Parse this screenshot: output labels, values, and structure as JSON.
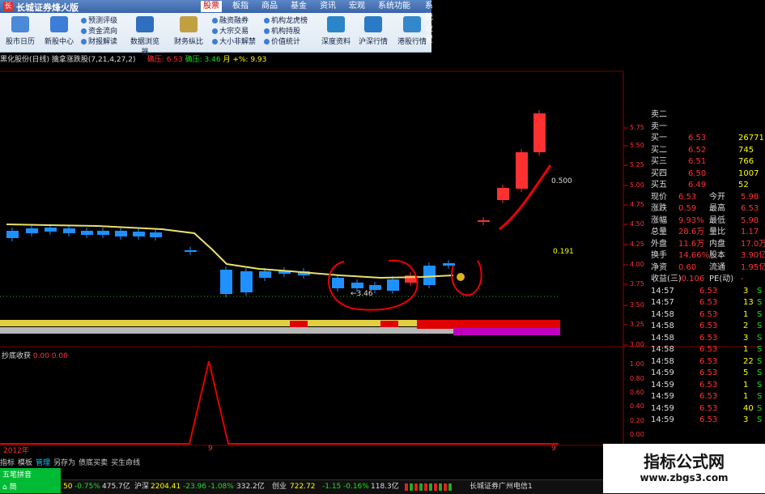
{
  "window": {
    "title": "长城证券烽火版",
    "menus": [
      "股票",
      "板指",
      "商品",
      "基金",
      "资讯",
      "宏观",
      "系统功能",
      "系统设置"
    ],
    "active_menu": "股票"
  },
  "toolbar": {
    "buttons": [
      "股市日历",
      "新股中心",
      "数据浏览器",
      "财务纵比",
      "深度资料",
      "沪深行情",
      "港股行情"
    ],
    "col1": [
      "预测评级",
      "资金流向",
      "财报解读"
    ],
    "col2": [
      "融资融券",
      "大宗交易",
      "大小非解禁"
    ],
    "col3": [
      "机构龙虎榜",
      "机构持股",
      "价值统计"
    ]
  },
  "infoline": {
    "stock": "黑化股份(日线)",
    "indicator": "擒拿涨跌股(7,21,4,27,2)",
    "high_label": "确压:",
    "high_val": "6.53",
    "low_label": "确压:",
    "low_val": "3.46",
    "month_label": "月 +%:",
    "month_val": "9.93"
  },
  "chart_labels": {
    "annotation_high": "0.500",
    "annotation_mid": "0.191",
    "low_mark": "←3.46",
    "sub_title": "抄底收获",
    "sub_val1": "0.00",
    "sub_val2": "0.00",
    "year_label": "2012年",
    "month_a": "9",
    "month_b": "9"
  },
  "price_axis": [
    "5.75",
    "5.50",
    "5.25",
    "5.00",
    "4.75",
    "4.50",
    "4.25",
    "4.00",
    "3.75",
    "3.50",
    "3.25",
    "3.00"
  ],
  "sub_axis": [
    "1.00",
    "0.80",
    "0.60",
    "0.40",
    "0.20",
    "0.00"
  ],
  "orderbook": {
    "asks": [
      {
        "l": "卖二",
        "p": "",
        "v": ""
      },
      {
        "l": "卖一",
        "p": "",
        "v": ""
      }
    ],
    "bids": [
      {
        "l": "买一",
        "p": "6.53",
        "v": "26771"
      },
      {
        "l": "买二",
        "p": "6.52",
        "v": "745"
      },
      {
        "l": "买三",
        "p": "6.51",
        "v": "766"
      },
      {
        "l": "买四",
        "p": "6.50",
        "v": "1007"
      },
      {
        "l": "买五",
        "p": "6.49",
        "v": "52"
      }
    ]
  },
  "quote": [
    {
      "a": "现价",
      "av": "6.53",
      "b": "今开",
      "bv": "5.98"
    },
    {
      "a": "涨跌",
      "av": "0.59",
      "b": "最高",
      "bv": "6.53"
    },
    {
      "a": "涨幅",
      "av": "9.93%",
      "b": "最低",
      "bv": "5.98"
    },
    {
      "a": "总量",
      "av": "28.6万",
      "b": "量比",
      "bv": "1.17"
    },
    {
      "a": "外盘",
      "av": "11.6万",
      "b": "内盘",
      "bv": "17.0万"
    },
    {
      "a": "换手",
      "av": "14.66%",
      "b": "股本",
      "bv": "3.90亿"
    },
    {
      "a": "净资",
      "av": "0.60",
      "b": "流通",
      "bv": "1.95亿"
    },
    {
      "a": "收益(三)",
      "av": "-0.106",
      "b": "PE(动)",
      "bv": "-"
    }
  ],
  "ticks": [
    {
      "t": "14:57",
      "p": "6.53",
      "v": "3",
      "s": "S"
    },
    {
      "t": "14:57",
      "p": "6.53",
      "v": "13",
      "s": "S"
    },
    {
      "t": "14:58",
      "p": "6.53",
      "v": "1",
      "s": "S"
    },
    {
      "t": "14:58",
      "p": "6.53",
      "v": "2",
      "s": "S"
    },
    {
      "t": "14:58",
      "p": "6.53",
      "v": "3",
      "s": "S"
    },
    {
      "t": "14:58",
      "p": "6.53",
      "v": "1",
      "s": "S"
    },
    {
      "t": "14:58",
      "p": "6.53",
      "v": "22",
      "s": "S"
    },
    {
      "t": "14:59",
      "p": "6.53",
      "v": "5",
      "s": "S"
    },
    {
      "t": "14:59",
      "p": "6.53",
      "v": "1",
      "s": "S"
    },
    {
      "t": "14:59",
      "p": "6.53",
      "v": "1",
      "s": "S"
    },
    {
      "t": "14:59",
      "p": "6.53",
      "v": "40",
      "s": "S"
    },
    {
      "t": "14:59",
      "p": "6.53",
      "v": "3",
      "s": "S"
    }
  ],
  "tabs": [
    "指标",
    "模板",
    "管理",
    "另存为",
    "债底买卖",
    "买生命线"
  ],
  "selected_tab": "管理",
  "ime": {
    "label": "五笔拼音",
    "mode": "简"
  },
  "status": {
    "sh_partial": "50",
    "sh_chg": "-0.75%",
    "sh_amt": "475.7亿",
    "sz_label": "沪深",
    "sz_val": "2204.41",
    "sz_chg": "-23.96",
    "sz_pct": "-1.08%",
    "sz_amt": "332.2亿",
    "cy_label": "创业",
    "cy_val": "722.72",
    "cy_chg": "-1.15",
    "cy_pct": "-0.16%",
    "cy_amt": "118.3亿",
    "broker": "长城证券广州电信1"
  },
  "watermark": {
    "title": "指标公式网",
    "url": "www.zbgs3.com"
  },
  "colors": {
    "up": "#ff3030",
    "down": "#1e90ff",
    "ma": "#e8e070",
    "accent": "#c00000"
  }
}
